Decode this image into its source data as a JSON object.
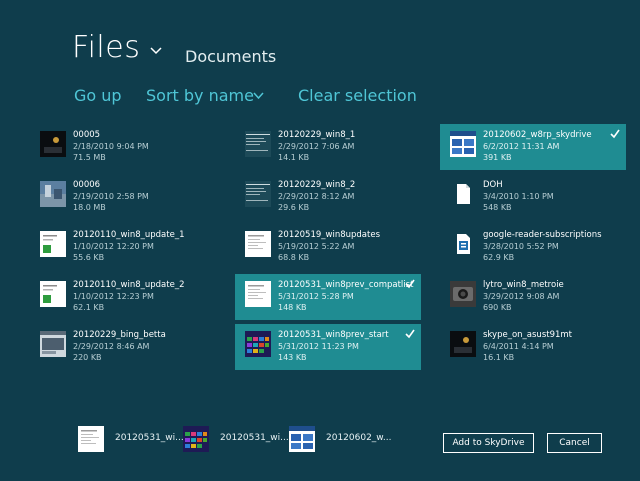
{
  "header": {
    "title": "Files",
    "location": "Documents"
  },
  "commands": {
    "go_up": "Go up",
    "sort": "Sort by name",
    "clear": "Clear selection"
  },
  "files": [
    {
      "name": "00005",
      "date": "2/18/2010 9:04 PM",
      "size": "71.5 MB",
      "selected": false,
      "thumb": "dark-photo"
    },
    {
      "name": "00006",
      "date": "2/19/2010 2:58 PM",
      "size": "18.0 MB",
      "selected": false,
      "thumb": "blue-photo"
    },
    {
      "name": "20120110_win8_update_1",
      "date": "1/10/2012 12:20 PM",
      "size": "55.6 KB",
      "selected": false,
      "thumb": "doc-green"
    },
    {
      "name": "20120110_win8_update_2",
      "date": "1/10/2012 12:23 PM",
      "size": "62.1 KB",
      "selected": false,
      "thumb": "doc-green"
    },
    {
      "name": "20120229_bing_betta",
      "date": "2/29/2012 8:46 AM",
      "size": "220 KB",
      "selected": false,
      "thumb": "screenshot"
    },
    {
      "name": "20120229_win8_1",
      "date": "2/29/2012 7:06 AM",
      "size": "14.1 KB",
      "selected": false,
      "thumb": "doc-lines"
    },
    {
      "name": "20120229_win8_2",
      "date": "2/29/2012 8:12 AM",
      "size": "29.6 KB",
      "selected": false,
      "thumb": "doc-lines"
    },
    {
      "name": "20120519_win8updates",
      "date": "5/19/2012 5:22 AM",
      "size": "68.8 KB",
      "selected": false,
      "thumb": "doc-plain"
    },
    {
      "name": "20120531_win8prev_compatlist",
      "date": "5/31/2012 5:28 PM",
      "size": "148 KB",
      "selected": true,
      "thumb": "doc-plain"
    },
    {
      "name": "20120531_win8prev_start",
      "date": "5/31/2012 11:23 PM",
      "size": "143 KB",
      "selected": true,
      "thumb": "tiles"
    },
    {
      "name": "20120602_w8rp_skydrive",
      "date": "6/2/2012 11:31 AM",
      "size": "391 KB",
      "selected": true,
      "thumb": "skydrive"
    },
    {
      "name": "DOH",
      "date": "3/4/2010 1:10 PM",
      "size": "548 KB",
      "selected": false,
      "thumb": "blank-doc"
    },
    {
      "name": "google-reader-subscriptions",
      "date": "3/28/2010 5:52 PM",
      "size": "62.9 KB",
      "selected": false,
      "thumb": "xml-doc"
    },
    {
      "name": "lytro_win8_metroie",
      "date": "3/29/2012 9:08 AM",
      "size": "690 KB",
      "selected": false,
      "thumb": "camera-photo"
    },
    {
      "name": "skype_on_asust91mt",
      "date": "6/4/2011 4:14 PM",
      "size": "16.1 KB",
      "selected": false,
      "thumb": "dark-photo"
    }
  ],
  "basket": [
    {
      "label": "20120531_wi...",
      "thumb": "doc-plain"
    },
    {
      "label": "20120531_wi...",
      "thumb": "tiles"
    },
    {
      "label": "20120602_w...",
      "thumb": "skydrive"
    }
  ],
  "buttons": {
    "add": "Add to SkyDrive",
    "cancel": "Cancel"
  },
  "colors": {
    "background": "#0f3d4c",
    "accent": "#4fc6d6",
    "selection": "#1f8c92"
  }
}
